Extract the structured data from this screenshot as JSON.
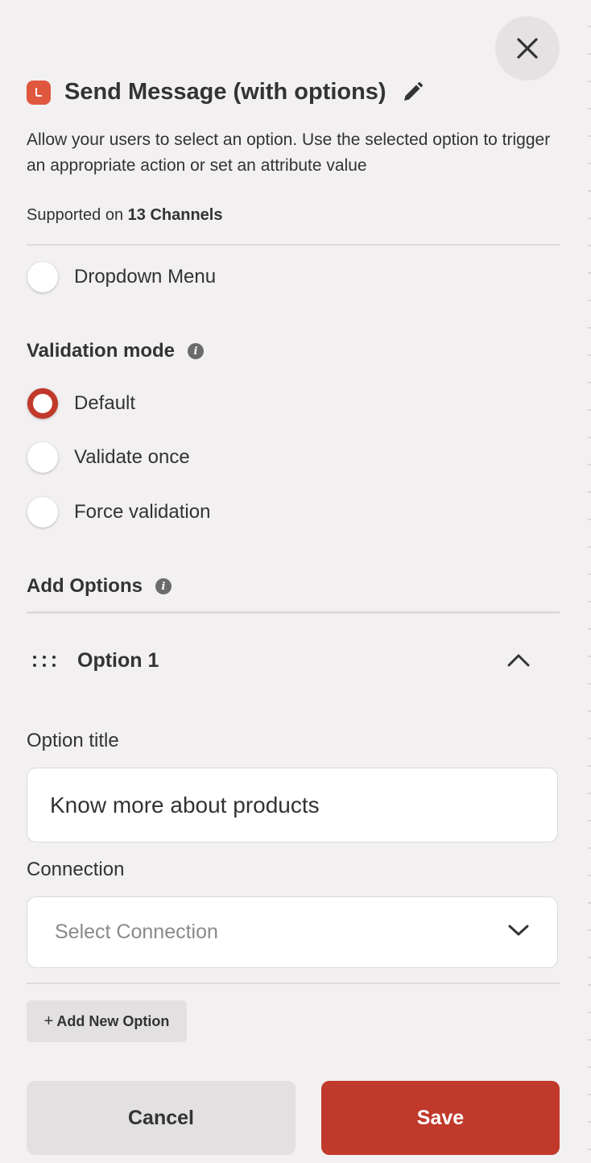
{
  "header": {
    "title": "Send Message (with options)",
    "description": "Allow your users to select an option. Use the selected option to trigger an appropriate action or set an attribute value",
    "supported_prefix": "Supported on ",
    "supported_channels": "13 Channels"
  },
  "dropdown_menu": {
    "label": "Dropdown Menu",
    "enabled": false
  },
  "validation": {
    "title": "Validation mode",
    "options": [
      {
        "label": "Default",
        "selected": true
      },
      {
        "label": "Validate once",
        "selected": false
      },
      {
        "label": "Force validation",
        "selected": false
      }
    ]
  },
  "add_options": {
    "title": "Add Options",
    "option": {
      "name": "Option 1",
      "title_label": "Option title",
      "title_value": "Know more about products",
      "connection_label": "Connection",
      "connection_placeholder": "Select Connection"
    },
    "add_new_label": "Add New Option"
  },
  "footer": {
    "cancel_label": "Cancel",
    "save_label": "Save"
  },
  "colors": {
    "accent": "#c0392b",
    "logo": "#e0573f",
    "background": "#f2f0f1"
  },
  "icons": {
    "close": "close-icon",
    "edit": "pencil-icon",
    "info": "info-icon",
    "drag": "drag-handle-icon",
    "collapse": "chevron-up-icon",
    "dropdown": "chevron-down-icon",
    "add": "plus-icon"
  }
}
